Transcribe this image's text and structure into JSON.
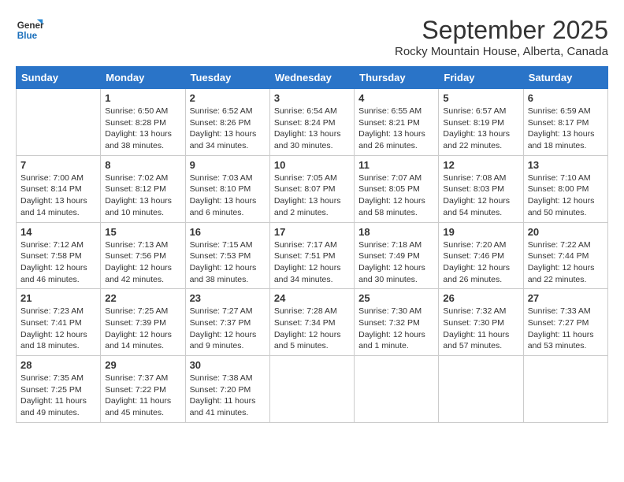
{
  "header": {
    "logo_line1": "General",
    "logo_line2": "Blue",
    "month": "September 2025",
    "location": "Rocky Mountain House, Alberta, Canada"
  },
  "days_of_week": [
    "Sunday",
    "Monday",
    "Tuesday",
    "Wednesday",
    "Thursday",
    "Friday",
    "Saturday"
  ],
  "weeks": [
    [
      {
        "date": "",
        "content": ""
      },
      {
        "date": "1",
        "content": "Sunrise: 6:50 AM\nSunset: 8:28 PM\nDaylight: 13 hours\nand 38 minutes."
      },
      {
        "date": "2",
        "content": "Sunrise: 6:52 AM\nSunset: 8:26 PM\nDaylight: 13 hours\nand 34 minutes."
      },
      {
        "date": "3",
        "content": "Sunrise: 6:54 AM\nSunset: 8:24 PM\nDaylight: 13 hours\nand 30 minutes."
      },
      {
        "date": "4",
        "content": "Sunrise: 6:55 AM\nSunset: 8:21 PM\nDaylight: 13 hours\nand 26 minutes."
      },
      {
        "date": "5",
        "content": "Sunrise: 6:57 AM\nSunset: 8:19 PM\nDaylight: 13 hours\nand 22 minutes."
      },
      {
        "date": "6",
        "content": "Sunrise: 6:59 AM\nSunset: 8:17 PM\nDaylight: 13 hours\nand 18 minutes."
      }
    ],
    [
      {
        "date": "7",
        "content": "Sunrise: 7:00 AM\nSunset: 8:14 PM\nDaylight: 13 hours\nand 14 minutes."
      },
      {
        "date": "8",
        "content": "Sunrise: 7:02 AM\nSunset: 8:12 PM\nDaylight: 13 hours\nand 10 minutes."
      },
      {
        "date": "9",
        "content": "Sunrise: 7:03 AM\nSunset: 8:10 PM\nDaylight: 13 hours\nand 6 minutes."
      },
      {
        "date": "10",
        "content": "Sunrise: 7:05 AM\nSunset: 8:07 PM\nDaylight: 13 hours\nand 2 minutes."
      },
      {
        "date": "11",
        "content": "Sunrise: 7:07 AM\nSunset: 8:05 PM\nDaylight: 12 hours\nand 58 minutes."
      },
      {
        "date": "12",
        "content": "Sunrise: 7:08 AM\nSunset: 8:03 PM\nDaylight: 12 hours\nand 54 minutes."
      },
      {
        "date": "13",
        "content": "Sunrise: 7:10 AM\nSunset: 8:00 PM\nDaylight: 12 hours\nand 50 minutes."
      }
    ],
    [
      {
        "date": "14",
        "content": "Sunrise: 7:12 AM\nSunset: 7:58 PM\nDaylight: 12 hours\nand 46 minutes."
      },
      {
        "date": "15",
        "content": "Sunrise: 7:13 AM\nSunset: 7:56 PM\nDaylight: 12 hours\nand 42 minutes."
      },
      {
        "date": "16",
        "content": "Sunrise: 7:15 AM\nSunset: 7:53 PM\nDaylight: 12 hours\nand 38 minutes."
      },
      {
        "date": "17",
        "content": "Sunrise: 7:17 AM\nSunset: 7:51 PM\nDaylight: 12 hours\nand 34 minutes."
      },
      {
        "date": "18",
        "content": "Sunrise: 7:18 AM\nSunset: 7:49 PM\nDaylight: 12 hours\nand 30 minutes."
      },
      {
        "date": "19",
        "content": "Sunrise: 7:20 AM\nSunset: 7:46 PM\nDaylight: 12 hours\nand 26 minutes."
      },
      {
        "date": "20",
        "content": "Sunrise: 7:22 AM\nSunset: 7:44 PM\nDaylight: 12 hours\nand 22 minutes."
      }
    ],
    [
      {
        "date": "21",
        "content": "Sunrise: 7:23 AM\nSunset: 7:41 PM\nDaylight: 12 hours\nand 18 minutes."
      },
      {
        "date": "22",
        "content": "Sunrise: 7:25 AM\nSunset: 7:39 PM\nDaylight: 12 hours\nand 14 minutes."
      },
      {
        "date": "23",
        "content": "Sunrise: 7:27 AM\nSunset: 7:37 PM\nDaylight: 12 hours\nand 9 minutes."
      },
      {
        "date": "24",
        "content": "Sunrise: 7:28 AM\nSunset: 7:34 PM\nDaylight: 12 hours\nand 5 minutes."
      },
      {
        "date": "25",
        "content": "Sunrise: 7:30 AM\nSunset: 7:32 PM\nDaylight: 12 hours\nand 1 minute."
      },
      {
        "date": "26",
        "content": "Sunrise: 7:32 AM\nSunset: 7:30 PM\nDaylight: 11 hours\nand 57 minutes."
      },
      {
        "date": "27",
        "content": "Sunrise: 7:33 AM\nSunset: 7:27 PM\nDaylight: 11 hours\nand 53 minutes."
      }
    ],
    [
      {
        "date": "28",
        "content": "Sunrise: 7:35 AM\nSunset: 7:25 PM\nDaylight: 11 hours\nand 49 minutes."
      },
      {
        "date": "29",
        "content": "Sunrise: 7:37 AM\nSunset: 7:22 PM\nDaylight: 11 hours\nand 45 minutes."
      },
      {
        "date": "30",
        "content": "Sunrise: 7:38 AM\nSunset: 7:20 PM\nDaylight: 11 hours\nand 41 minutes."
      },
      {
        "date": "",
        "content": ""
      },
      {
        "date": "",
        "content": ""
      },
      {
        "date": "",
        "content": ""
      },
      {
        "date": "",
        "content": ""
      }
    ]
  ]
}
